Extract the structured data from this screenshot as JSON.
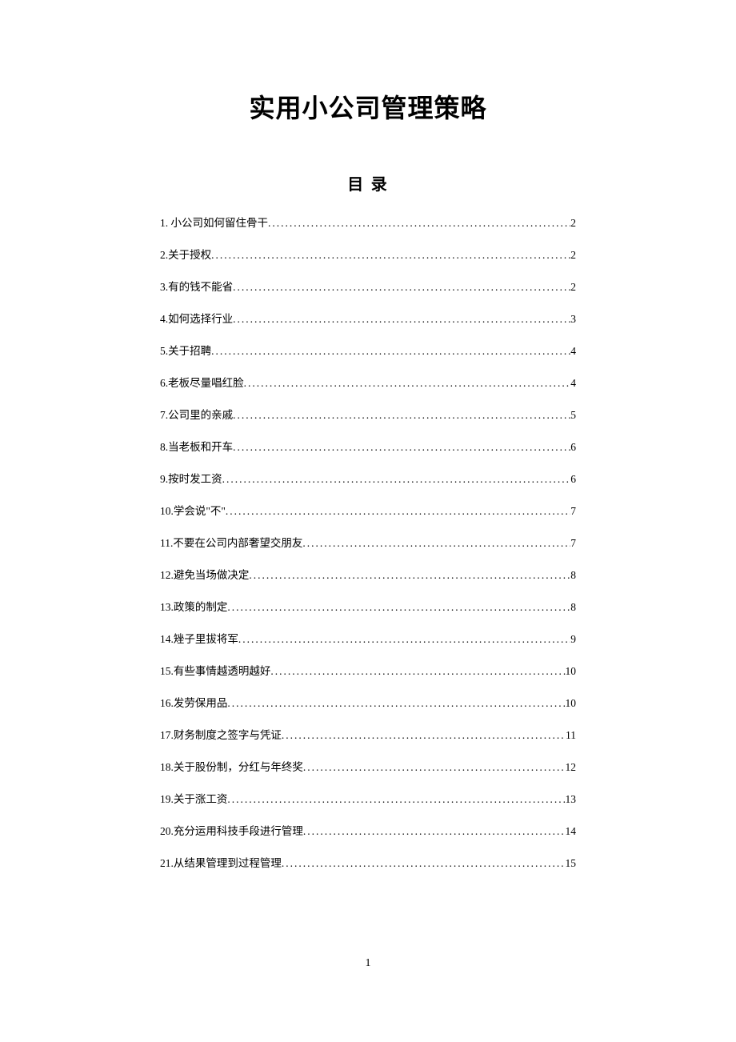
{
  "document": {
    "title": "实用小公司管理策略",
    "toc_title": "目   录",
    "page_number": "1"
  },
  "toc": [
    {
      "label": "1. 小公司如何留住骨干",
      "page": "2"
    },
    {
      "label": "2.关于授权",
      "page": "2"
    },
    {
      "label": "3.有的钱不能省",
      "page": "2"
    },
    {
      "label": "4.如何选择行业",
      "page": "3"
    },
    {
      "label": "5.关于招聘",
      "page": "4"
    },
    {
      "label": "6.老板尽量唱红脸",
      "page": "4"
    },
    {
      "label": "7.公司里的亲戚",
      "page": "5"
    },
    {
      "label": "8.当老板和开车",
      "page": "6"
    },
    {
      "label": "9.按时发工资",
      "page": "6"
    },
    {
      "label": "10.学会说\"不\"",
      "page": "7"
    },
    {
      "label": "11.不要在公司内部奢望交朋友",
      "page": "7"
    },
    {
      "label": "12.避免当场做决定",
      "page": "8"
    },
    {
      "label": "13.政策的制定",
      "page": "8"
    },
    {
      "label": "14.矬子里拔将军",
      "page": "9"
    },
    {
      "label": "15.有些事情越透明越好",
      "page": "10"
    },
    {
      "label": "16.发劳保用品",
      "page": "10"
    },
    {
      "label": "17.财务制度之签字与凭证",
      "page": "11"
    },
    {
      "label": "18.关于股份制，分红与年终奖",
      "page": "12"
    },
    {
      "label": "19.关于涨工资",
      "page": "13"
    },
    {
      "label": "20.充分运用科技手段进行管理",
      "page": "14"
    },
    {
      "label": "21.从结果管理到过程管理",
      "page": "15"
    }
  ]
}
